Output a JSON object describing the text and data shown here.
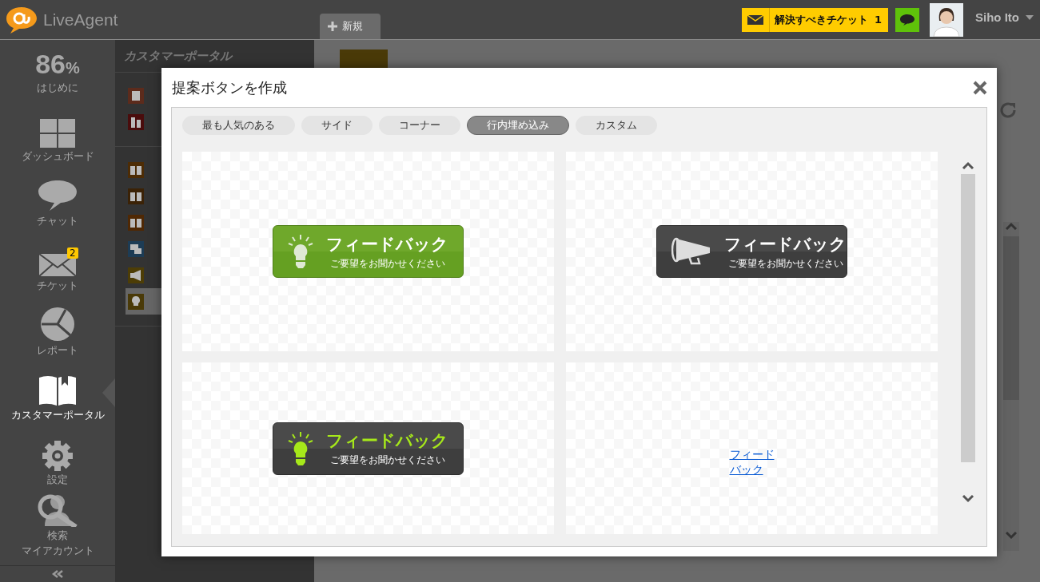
{
  "app": {
    "logo": "LiveAgent"
  },
  "tabs": [
    {
      "label": "新規",
      "selected": true
    }
  ],
  "header": {
    "ticket_button": {
      "label": "解決すべきチケット",
      "count": "1"
    },
    "user": {
      "name": "Siho Ito"
    }
  },
  "nav": {
    "progress": {
      "value": "86",
      "unit": "%",
      "label": "はじめに"
    },
    "items": [
      {
        "kind": "dashboard",
        "label": "ダッシュボード",
        "selected": false
      },
      {
        "kind": "chat",
        "label": "チャット",
        "selected": false
      },
      {
        "kind": "ticket",
        "label": "チケット",
        "badge": "2",
        "selected": false
      },
      {
        "kind": "report",
        "label": "レポート",
        "selected": false
      },
      {
        "kind": "portal",
        "label": "カスタマーポータル",
        "selected": true
      },
      {
        "kind": "settings",
        "label": "設定",
        "selected": false
      },
      {
        "kind": "search",
        "label": "検索",
        "selected": false
      },
      {
        "kind": "account",
        "label": "マイアカウント",
        "selected": false,
        "overlaps_previous": true
      }
    ]
  },
  "subpanel": {
    "title": "カスタマーポータル",
    "sections": [
      [
        {
          "color": "#5c2b1c",
          "selected": false
        },
        {
          "color": "#4a0c0c",
          "selected": false
        }
      ],
      [
        {
          "color": "#4d2c05",
          "selected": false
        },
        {
          "color": "#3b2206",
          "selected": false
        },
        {
          "color": "#4f2804",
          "selected": false
        },
        {
          "color": "#1d3c55",
          "selected": false
        },
        {
          "color": "#4d3d06",
          "selected": false
        },
        {
          "color": "#4a3a08",
          "selected": true
        }
      ]
    ]
  },
  "dialog": {
    "title": "提案ボタンを作成",
    "tabs": [
      {
        "label": "最も人気のある",
        "selected": false
      },
      {
        "label": "サイド",
        "selected": false
      },
      {
        "label": "コーナー",
        "selected": false
      },
      {
        "label": "行内埋め込み",
        "selected": true
      },
      {
        "label": "カスタム",
        "selected": false
      }
    ],
    "previews": [
      {
        "kind": "button",
        "title": "フィードバック",
        "subtitle": "ご要望をお聞かせください"
      },
      {
        "kind": "button",
        "title": "フィードバック",
        "subtitle": "ご要望をお聞かせください"
      },
      {
        "kind": "button",
        "title": "フィードバック",
        "subtitle": "ご要望をお聞かせください"
      },
      {
        "kind": "link",
        "title": "フィードバック"
      }
    ]
  }
}
